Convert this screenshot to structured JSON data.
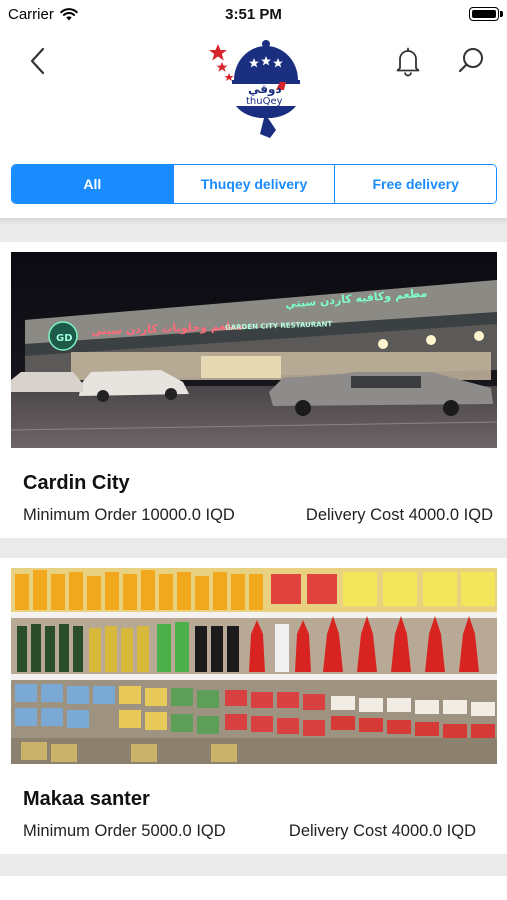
{
  "status_bar": {
    "carrier": "Carrier",
    "time": "3:51 PM"
  },
  "header": {
    "logo_text_arabic": "ذوقي",
    "logo_text_latin": "thuQey",
    "back_icon": "chevron-left-icon",
    "notifications_icon": "bell-icon",
    "search_icon": "search-icon"
  },
  "filters": {
    "tabs": [
      {
        "label": "All",
        "active": true
      },
      {
        "label": "Thuqey delivery",
        "active": false
      },
      {
        "label": "Free delivery",
        "active": false
      }
    ]
  },
  "stores": [
    {
      "name": "Cardin City",
      "min_order": "Minimum Order 10000.0 IQD",
      "delivery_cost": "Delivery Cost 4000.0 IQD",
      "image_sign_arabic_1": "مطعم وكافيه كاردن سيتي",
      "image_sign_arabic_2": "مطعم وحلويات كاردن سيتي",
      "image_sign_latin": "GARDEN CITY RESTAURANT"
    },
    {
      "name": "Makaa santer",
      "min_order": "Minimum Order 5000.0 IQD",
      "delivery_cost": "Delivery Cost 4000.0 IQD"
    }
  ],
  "colors": {
    "accent": "#1a8cff",
    "logo_navy": "#1b2f80",
    "logo_red": "#d6262b",
    "list_background": "#eaeaea"
  }
}
